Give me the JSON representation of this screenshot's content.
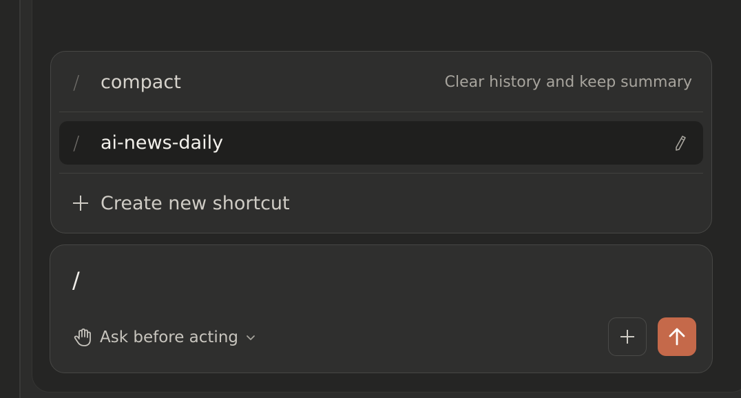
{
  "shortcut_menu": {
    "items": [
      {
        "prefix": "/",
        "name": "compact",
        "description": "Clear history and keep summary",
        "icon": "slash-icon"
      },
      {
        "prefix": "/",
        "name": "ai-news-daily",
        "action_icon": "pencil-icon",
        "selected": true
      }
    ],
    "create": {
      "label": "Create new shortcut",
      "icon": "plus-icon"
    }
  },
  "composer": {
    "input_value": "/",
    "mode": {
      "label": "Ask before acting",
      "icon": "hand-icon"
    },
    "attach_icon": "plus-icon",
    "send_icon": "arrow-up-icon"
  },
  "colors": {
    "background": "#252524",
    "accent": "#c5694a",
    "selected_row": "#1f1f1e"
  }
}
